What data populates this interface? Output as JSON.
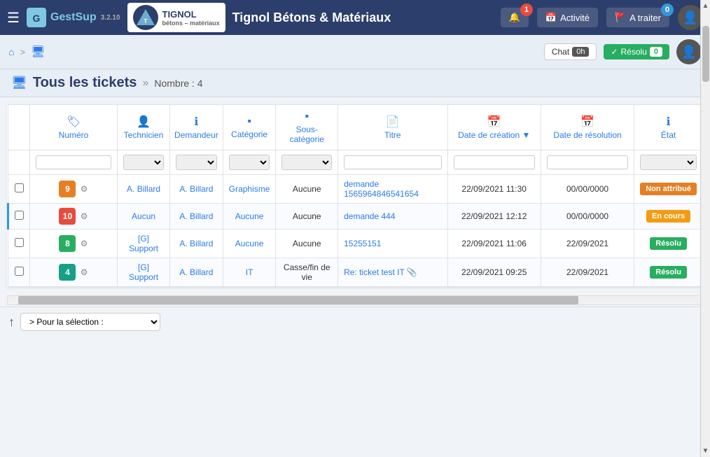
{
  "app": {
    "name": "GestSup",
    "version": "3.2.10"
  },
  "company": {
    "logo_text": "T",
    "name": "Tignol Bétons & Matériaux",
    "sub": "bétons – matériaux"
  },
  "topnav": {
    "hamburger": "☰",
    "activite_label": "Activité",
    "a_traiter_label": "A traiter",
    "notification_count": "1",
    "a_traiter_count": "0"
  },
  "subheader": {
    "home_icon": "⌂",
    "ticket_icon": "🖥",
    "separator": ">",
    "time_label": "0h",
    "chat_label": "Chat",
    "resolved_label": "Résolu",
    "resolved_count": "0"
  },
  "page_title": {
    "icon": "🖥",
    "title": "Tous les tickets",
    "separator": "»",
    "count_label": "Nombre : 4"
  },
  "table": {
    "columns": [
      {
        "id": "numero",
        "icon": "🏷",
        "label": "Numéro"
      },
      {
        "id": "technicien",
        "icon": "👤",
        "label": "Technicien"
      },
      {
        "id": "demandeur",
        "icon": "ℹ",
        "label": "Demandeur"
      },
      {
        "id": "categorie",
        "icon": "▪",
        "label": "Catégorie"
      },
      {
        "id": "sous-categorie",
        "icon": "▪",
        "label": "Sous-catégorie"
      },
      {
        "id": "titre",
        "icon": "📄",
        "label": "Titre"
      },
      {
        "id": "date-creation",
        "icon": "📅",
        "label": "Date de création ▼"
      },
      {
        "id": "date-resolution",
        "icon": "📅",
        "label": "Date de résolution"
      },
      {
        "id": "etat",
        "icon": "ℹ",
        "label": "État"
      }
    ],
    "rows": [
      {
        "id": "row-9",
        "number": "9",
        "num_color": "orange",
        "technicien": "A. Billard",
        "demandeur": "A. Billard",
        "categorie": "Graphisme",
        "sous_categorie": "Aucune",
        "titre": "demande 1565964846541654",
        "date_creation": "22/09/2021 11:30",
        "date_resolution": "00/00/0000",
        "etat": "Non attribué",
        "etat_class": "non-attribue",
        "accent": false
      },
      {
        "id": "row-10",
        "number": "10",
        "num_color": "red",
        "technicien": "Aucun",
        "demandeur": "A. Billard",
        "categorie": "Aucune",
        "sous_categorie": "Aucune",
        "titre": "demande 444",
        "date_creation": "22/09/2021 12:12",
        "date_resolution": "00/00/0000",
        "etat": "En cours",
        "etat_class": "en-cours",
        "accent": true
      },
      {
        "id": "row-8",
        "number": "8",
        "num_color": "green",
        "technicien": "[G] Support",
        "demandeur": "A. Billard",
        "categorie": "Aucune",
        "sous_categorie": "Aucune",
        "titre": "15255151",
        "date_creation": "22/09/2021 11:06",
        "date_resolution": "22/09/2021",
        "etat": "Résolu",
        "etat_class": "resolu",
        "accent": false
      },
      {
        "id": "row-4",
        "number": "4",
        "num_color": "teal",
        "technicien": "[G] Support",
        "demandeur": "A. Billard",
        "categorie": "IT",
        "sous_categorie": "Casse/fin de vie",
        "titre": "Re: ticket test IT 📎",
        "date_creation": "22/09/2021 09:25",
        "date_resolution": "22/09/2021",
        "etat": "Résolu",
        "etat_class": "resolu",
        "accent": false
      }
    ]
  },
  "bottom": {
    "selection_label": "> Pour la sélection :",
    "selection_options": [
      "> Pour la sélection :"
    ]
  }
}
